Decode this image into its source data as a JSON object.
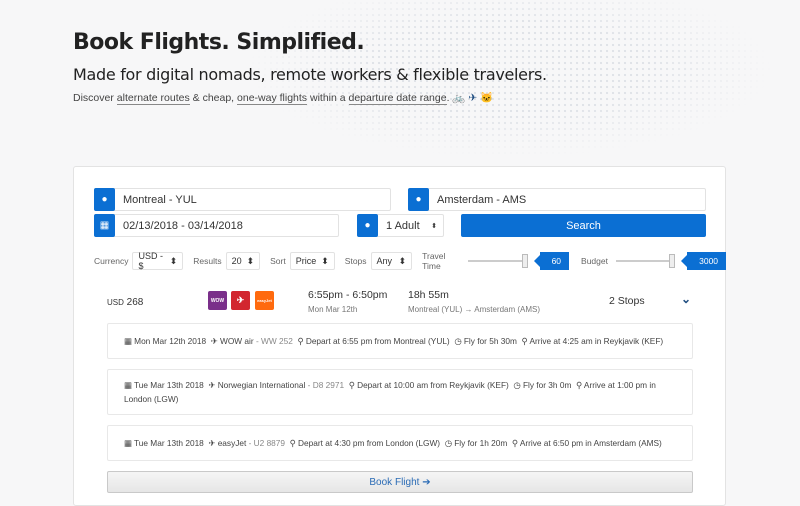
{
  "hero": {
    "title": "Book Flights. Simplified.",
    "subtitle": "Made for digital nomads, remote workers & flexible travelers.",
    "desc_1": "Discover ",
    "link_1": "alternate routes",
    "desc_2": " & cheap, ",
    "link_2": "one-way flights",
    "desc_3": " within a ",
    "link_3": "departure date range",
    "desc_4": ".",
    "emoji": "🚲 ✈ 🐱"
  },
  "search": {
    "origin": "Montreal - YUL",
    "destination": "Amsterdam - AMS",
    "dates": "02/13/2018 - 03/14/2018",
    "passengers": "1 Adult",
    "search_label": "Search"
  },
  "filters": {
    "currency_label": "Currency",
    "currency": "USD - $",
    "results_label": "Results",
    "results": "20",
    "sort_label": "Sort",
    "sort": "Price",
    "stops_label": "Stops",
    "stops": "Any",
    "travel_label": "Travel Time",
    "travel_value": "60",
    "budget_label": "Budget",
    "budget_value": "3000"
  },
  "result": {
    "currency": "USD",
    "price": "268",
    "airlines": [
      "WOW",
      "✈",
      "easyJet"
    ],
    "times": "6:55pm - 6:50pm",
    "date": "Mon Mar 12th",
    "duration": "18h 55m",
    "route": "Montreal (YUL) → Amsterdam (AMS)",
    "stops": "2 Stops",
    "legs": [
      {
        "date": "Mon Mar 12th 2018",
        "airline": "WOW air",
        "flight": " - WW 252",
        "depart": "Depart at 6:55 pm from Montreal (YUL)",
        "fly": "Fly for 5h 30m",
        "arrive": "Arrive at 4:25 am in Reykjavik (KEF)"
      },
      {
        "date": "Tue Mar 13th 2018",
        "airline": "Norwegian International",
        "flight": " - D8 2971",
        "depart": "Depart at 10:00 am from Reykjavik (KEF)",
        "fly": "Fly for 3h 0m",
        "arrive": "Arrive at 1:00 pm in London (LGW)"
      },
      {
        "date": "Tue Mar 13th 2018",
        "airline": "easyJet",
        "flight": " - U2 8879",
        "depart": "Depart at 4:30 pm from London (LGW)",
        "fly": "Fly for 1h 20m",
        "arrive": "Arrive at 6:50 pm in Amsterdam (AMS)"
      }
    ],
    "book_label": "Book Flight"
  }
}
